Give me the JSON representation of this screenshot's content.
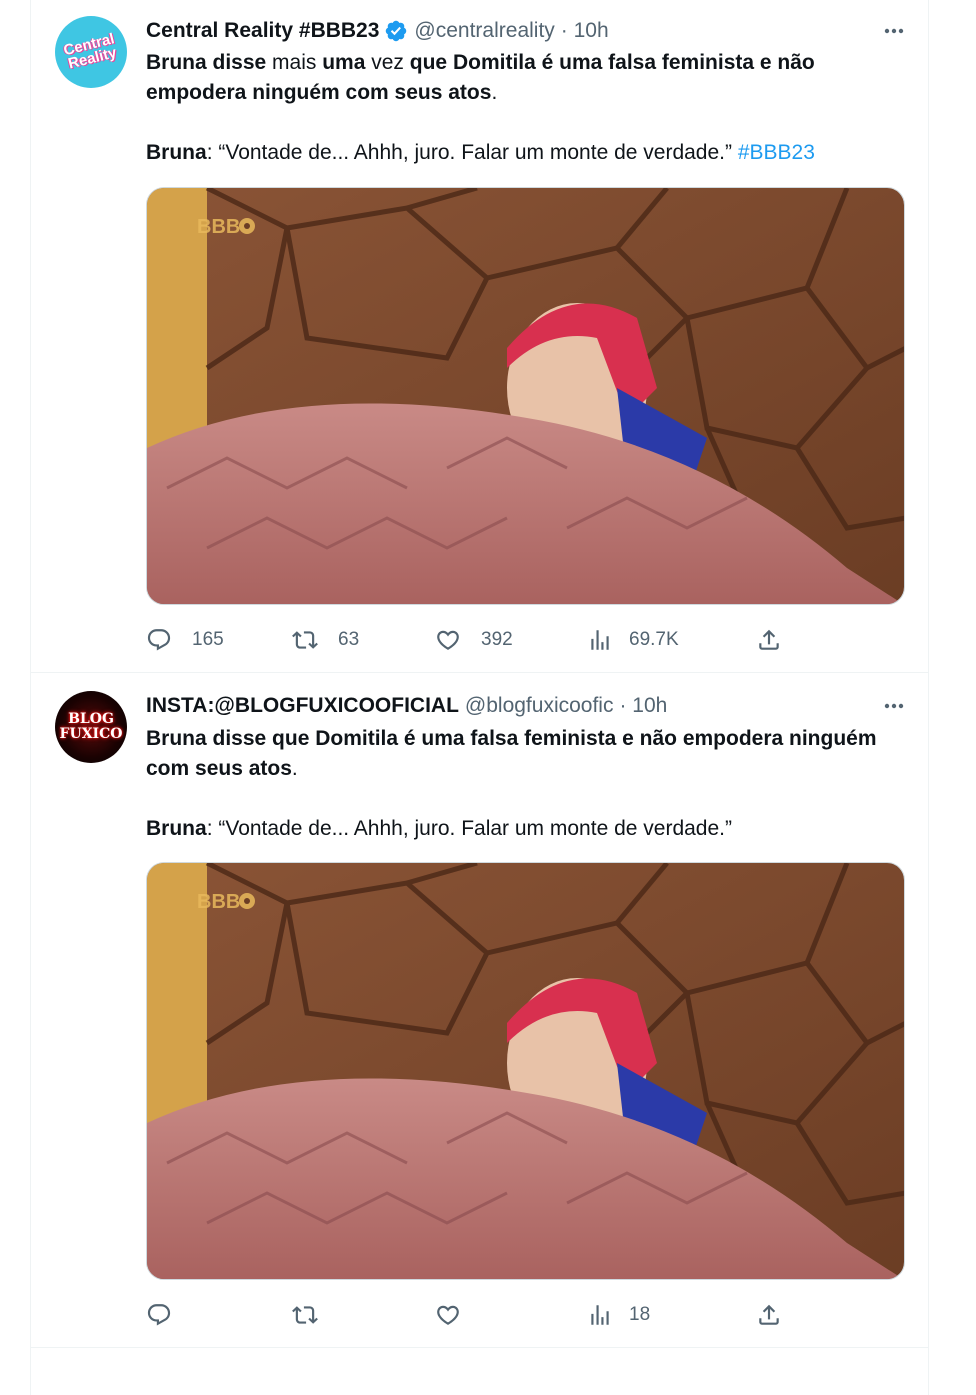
{
  "tweets": [
    {
      "name": "Central Reality #BBB23",
      "handle": "@centralreality",
      "time": "· 10h",
      "avatar_text": [
        "Central",
        "Reality"
      ],
      "text": {
        "l1_a": "Bruna disse",
        "l1_b": " mais ",
        "l1_c": "uma",
        "l1_d": " vez ",
        "l1_e": "que Domitila é uma falsa feminista e não empodera ninguém com seus atos",
        "l1_f": ".",
        "l2_a": "Bruna",
        "l2_b": ": “Vontade de... Ahhh, juro. Falar um monte de verdade.” ",
        "l2_tag": "#BBB23"
      },
      "image_watermark": "BBB",
      "stats": {
        "replies": "165",
        "retweets": "63",
        "likes": "392",
        "views": "69.7K"
      }
    },
    {
      "name": "INSTA:@BLOGFUXICOOFICIAL",
      "handle": "@blogfuxicoofic",
      "time": "· 10h",
      "avatar_text": [
        "BLOG",
        "FUXICO"
      ],
      "text": {
        "l1_a": "Bruna disse que Domitila é uma falsa feminista e não empodera ninguém com seus atos",
        "l1_f": ".",
        "l2_a": "Bruna",
        "l2_b": ": “Vontade de... Ahhh, juro. Falar um monte de verdade.”"
      },
      "image_watermark": "BBB",
      "stats": {
        "replies": "",
        "retweets": "",
        "likes": "",
        "views": "18"
      }
    }
  ],
  "colors": {
    "text": "#0f1419",
    "secondary": "#536471",
    "link": "#1d9bf0",
    "verified": "#1d9bf0",
    "border": "#eff3f4"
  },
  "icons": [
    "reply-icon",
    "retweet-icon",
    "like-icon",
    "views-icon",
    "share-icon",
    "more-icon",
    "verified-badge-icon"
  ]
}
